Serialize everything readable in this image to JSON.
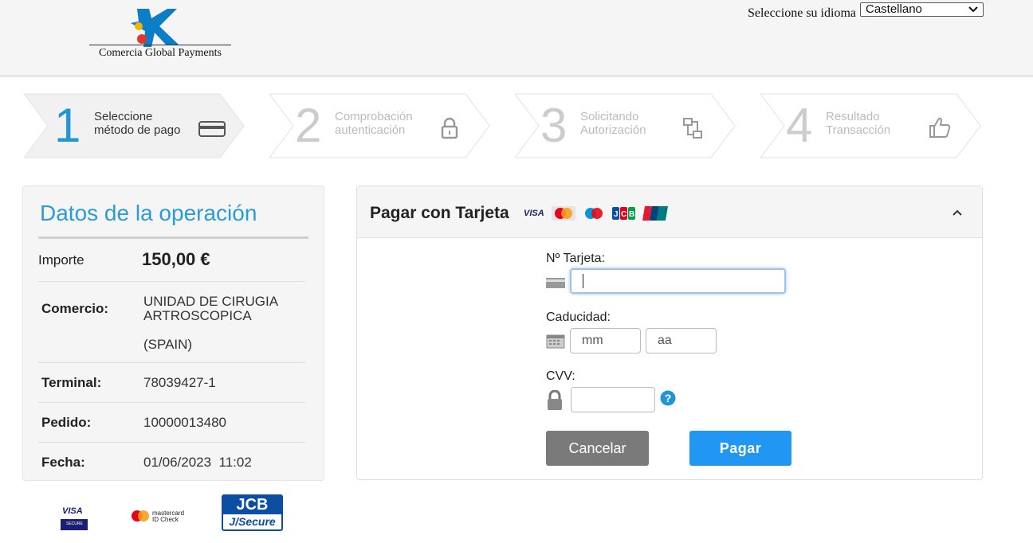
{
  "header": {
    "logo_text": "Comercia Global Payments",
    "language_label": "Seleccione su idioma",
    "language_selected": "Castellano"
  },
  "steps": [
    {
      "number": "1",
      "line1": "Seleccione",
      "line2": "método de pago",
      "icon": "card-icon",
      "active": true
    },
    {
      "number": "2",
      "line1": "Comprobación",
      "line2": "autenticación",
      "icon": "lock-icon",
      "active": false
    },
    {
      "number": "3",
      "line1": "Solicitando",
      "line2": "Autorización",
      "icon": "network-icon",
      "active": false
    },
    {
      "number": "4",
      "line1": "Resultado",
      "line2": "Transacción",
      "icon": "thumbs-up-icon",
      "active": false
    }
  ],
  "operation": {
    "title": "Datos de la operación",
    "amount_label": "Importe",
    "amount_value": "150,00 €",
    "merchant_label": "Comercio:",
    "merchant_line1": "UNIDAD DE CIRUGIA",
    "merchant_line2": "ARTROSCOPICA",
    "merchant_line3": "(SPAIN)",
    "terminal_label": "Terminal:",
    "terminal_value": "78039427-1",
    "order_label": "Pedido:",
    "order_value": "10000013480",
    "date_label": "Fecha:",
    "date_value": "01/06/2023  11:02"
  },
  "payment": {
    "title": "Pagar con Tarjeta",
    "brands": [
      "VISA",
      "Mastercard",
      "Maestro",
      "JCB",
      "UnionPay"
    ],
    "card_label": "Nº Tarjeta:",
    "card_value": "",
    "expiry_label": "Caducidad:",
    "month_placeholder": "mm",
    "year_placeholder": "aa",
    "cvv_label": "CVV:",
    "cvv_value": "",
    "cancel_label": "Cancelar",
    "pay_label": "Pagar"
  },
  "footer": {
    "visa_text": "VISA",
    "visa_sub": "SECURE",
    "mc_line1": "mastercard",
    "mc_line2": "ID Check",
    "jcb_text": "JCB",
    "jcb_sub": "J/Secure"
  },
  "colors": {
    "accent": "#2196d3",
    "pay_button": "#2196f3",
    "cancel_button": "#7a7a7a"
  }
}
